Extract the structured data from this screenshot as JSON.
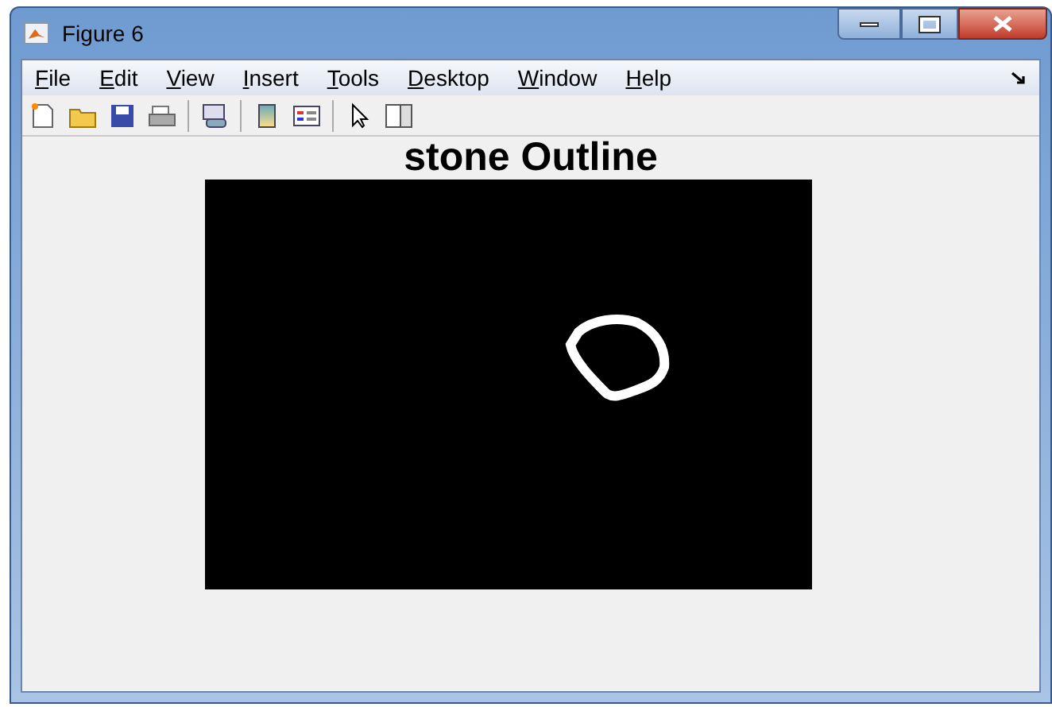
{
  "window": {
    "title": "Figure 6"
  },
  "menu": [
    {
      "label": "File"
    },
    {
      "label": "Edit"
    },
    {
      "label": "View"
    },
    {
      "label": "Insert"
    },
    {
      "label": "Tools"
    },
    {
      "label": "Desktop"
    },
    {
      "label": "Window"
    },
    {
      "label": "Help"
    }
  ],
  "figure": {
    "title": "stone Outline"
  }
}
